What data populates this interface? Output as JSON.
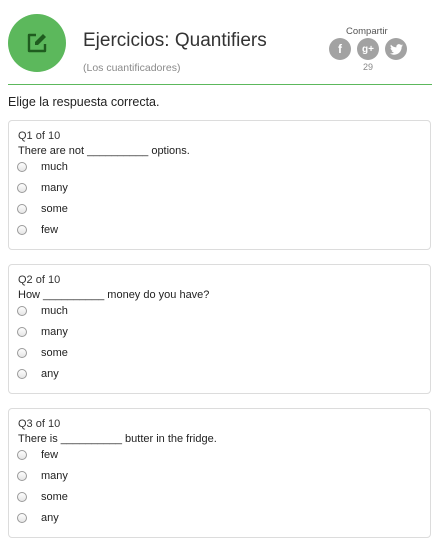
{
  "header": {
    "title": "Ejercicios: Quantifiers",
    "subtitle": "(Los cuantificadores)",
    "logo_icon": "edit-icon",
    "accent_color": "#5cb85c",
    "share": {
      "label": "Compartir",
      "count": "29",
      "buttons": [
        {
          "icon": "facebook-icon",
          "glyph": "f"
        },
        {
          "icon": "google-plus-icon",
          "glyph": "g+"
        },
        {
          "icon": "twitter-icon",
          "glyph": "bird"
        }
      ]
    }
  },
  "instruction": "Elige la respuesta correcta.",
  "questions": [
    {
      "number": "Q1 of 10",
      "text": "There are not __________ options.",
      "options": [
        "much",
        "many",
        "some",
        "few"
      ]
    },
    {
      "number": "Q2 of 10",
      "text": "How __________ money do you have?",
      "options": [
        "much",
        "many",
        "some",
        "any"
      ]
    },
    {
      "number": "Q3 of 10",
      "text": "There is __________ butter in the fridge.",
      "options": [
        "few",
        "many",
        "some",
        "any"
      ]
    }
  ]
}
